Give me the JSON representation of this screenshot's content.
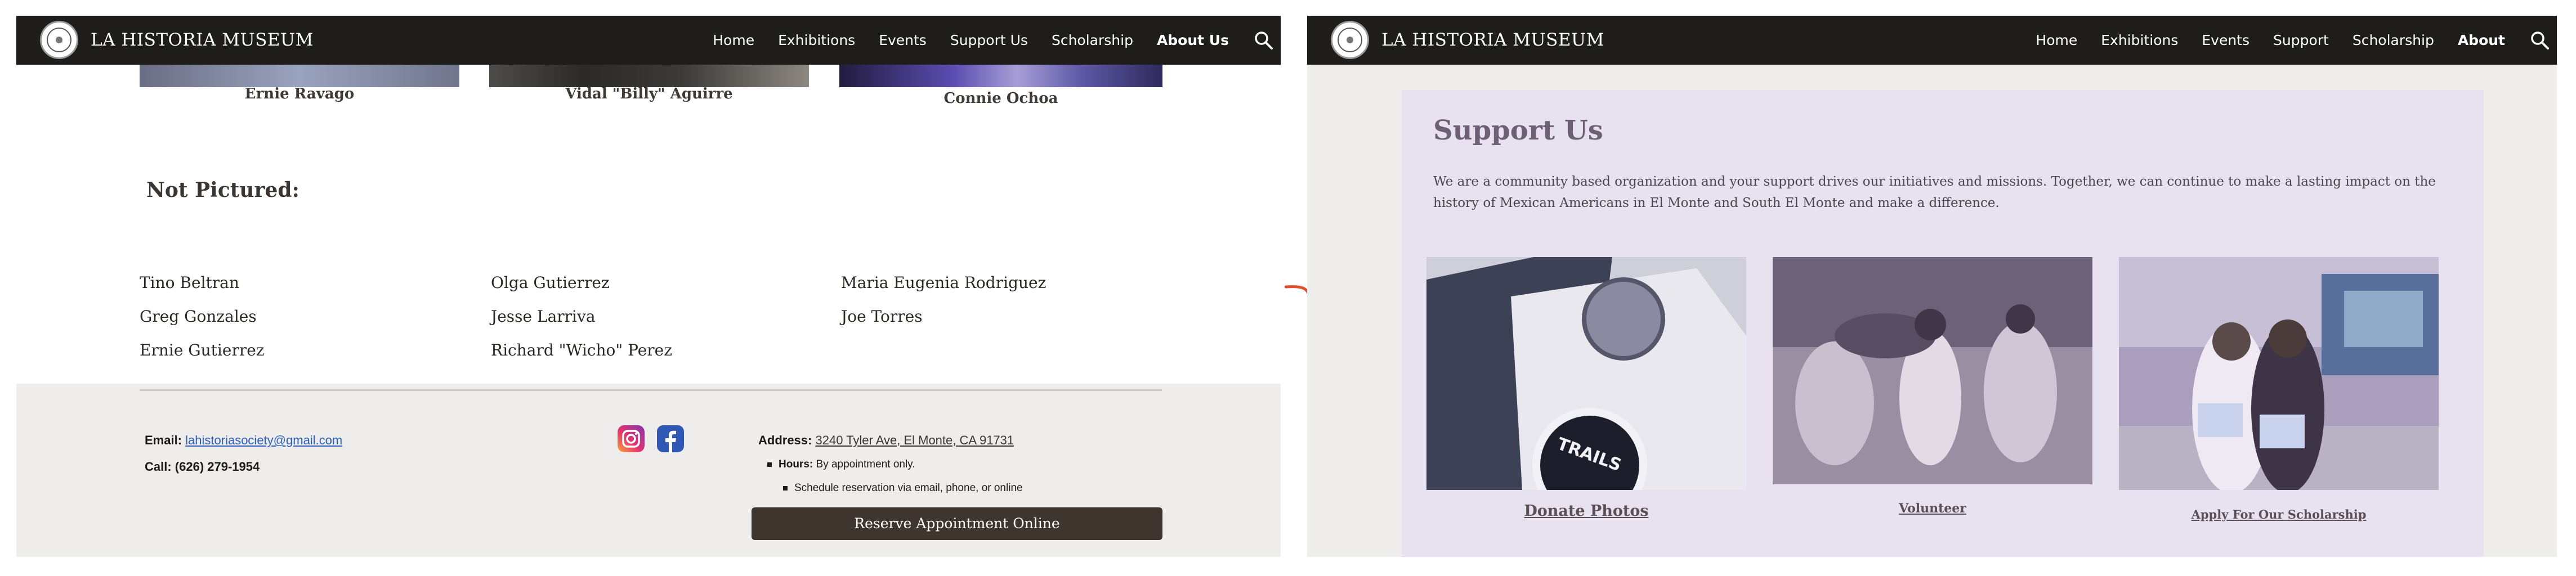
{
  "nav": {
    "title": "LA HISTORIA MUSEUM",
    "left_items": [
      "Home",
      "Exhibitions",
      "Events",
      "Support Us",
      "Scholarship",
      "About Us"
    ],
    "right_items": [
      "Home",
      "Exhibitions",
      "Events",
      "Support",
      "Scholarship",
      "About"
    ]
  },
  "left": {
    "people": [
      "Ernie Ravago",
      "Vidal \"Billy\" Aguirre",
      "Connie Ochoa"
    ],
    "not_pictured_heading": "Not Pictured:",
    "not_pictured": [
      [
        "Tino Beltran",
        "Greg Gonzales",
        "Ernie Gutierrez"
      ],
      [
        "Olga Gutierrez",
        "Jesse Larriva",
        "Richard \"Wicho\" Perez"
      ],
      [
        "Maria Eugenia Rodriguez",
        "Joe Torres"
      ]
    ],
    "footer": {
      "email_label": "Email:",
      "email": "lahistoriasociety@gmail.com",
      "call": "Call: (626) 279-1954",
      "address_label": "Address:",
      "address": "3240 Tyler Ave, El Monte, CA 91731",
      "hours_label": "Hours:",
      "hours": "By appointment only.",
      "schedule": "Schedule reservation via email, phone, or online",
      "reserve_button": "Reserve Appointment Online"
    }
  },
  "right": {
    "title": "Support Us",
    "description": "We are a community based organization and your support drives our initiatives and missions. Together, we can continue to make a lasting impact on the history of Mexican Americans in El Monte and South El Monte and make a difference.",
    "cards": [
      "Donate Photos",
      "Volunteer",
      "Apply For Our Scholarship"
    ]
  },
  "colors": {
    "navbar": "#1f1d1c",
    "footer_bg": "#efedeb",
    "support_bg": "#e8e2f0",
    "button": "#3e362e",
    "arrow": "#e2502c",
    "link": "#2a5fbf"
  }
}
